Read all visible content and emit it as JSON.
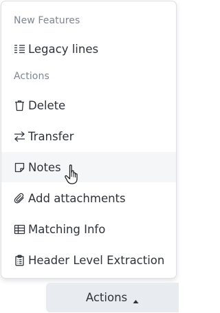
{
  "menu": {
    "section_new_features": "New Features",
    "section_actions": "Actions",
    "items": [
      {
        "label": "Legacy lines",
        "icon": "list-lines-icon"
      },
      {
        "label": "Delete",
        "icon": "trash-icon"
      },
      {
        "label": "Transfer",
        "icon": "transfer-arrows-icon"
      },
      {
        "label": "Notes",
        "icon": "note-icon"
      },
      {
        "label": "Add attachments",
        "icon": "paperclip-icon"
      },
      {
        "label": "Matching Info",
        "icon": "table-icon"
      },
      {
        "label": "Header Level Extraction",
        "icon": "clipboard-list-icon"
      }
    ]
  },
  "button": {
    "label": "Actions",
    "icon": "caret-up-icon"
  },
  "colors": {
    "text": "#2e333a",
    "section_text": "#7d8592",
    "hover_bg": "#f5f6f8",
    "button_bg": "#e8ebef",
    "border": "#dcdfe4"
  }
}
